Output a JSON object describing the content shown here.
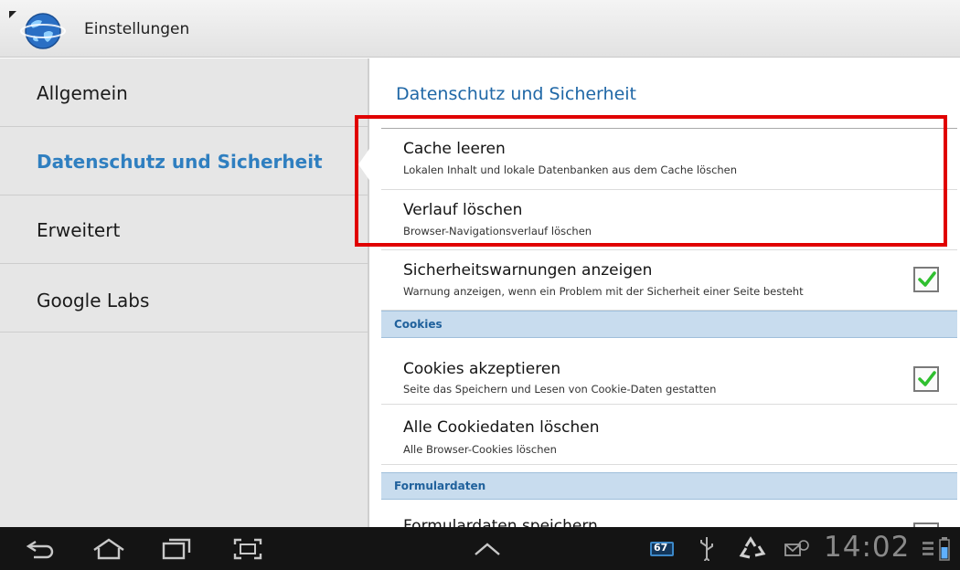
{
  "app": {
    "title": "Einstellungen"
  },
  "sidebar": {
    "items": [
      {
        "label": "Allgemein",
        "selected": false
      },
      {
        "label": "Datenschutz und Sicherheit",
        "selected": true
      },
      {
        "label": "Erweitert",
        "selected": false
      },
      {
        "label": "Google Labs",
        "selected": false
      }
    ]
  },
  "main": {
    "title": "Datenschutz und Sicherheit",
    "prefs": [
      {
        "title": "Cache leeren",
        "summary": "Lokalen Inhalt und lokale Datenbanken aus dem Cache löschen"
      },
      {
        "title": "Verlauf löschen",
        "summary": "Browser-Navigationsverlauf löschen"
      },
      {
        "title": "Sicherheitswarnungen anzeigen",
        "summary": "Warnung anzeigen, wenn ein Problem mit der Sicherheit einer Seite besteht",
        "checked": true
      }
    ],
    "cookies": {
      "header": "Cookies",
      "prefs": [
        {
          "title": "Cookies akzeptieren",
          "summary": "Seite das Speichern und Lesen von Cookie-Daten gestatten",
          "checked": true
        },
        {
          "title": "Alle Cookiedaten löschen",
          "summary": "Alle Browser-Cookies löschen"
        }
      ]
    },
    "formdata": {
      "header": "Formulardaten",
      "prefs": [
        {
          "title": "Formulardaten speichern"
        }
      ]
    }
  },
  "statusbar": {
    "clock": "14:02",
    "badge": "67"
  },
  "colors": {
    "accent": "#2f7fc0",
    "category_bg": "#c8dcee",
    "highlight": "#e00000",
    "check": "#2fbf2f"
  }
}
